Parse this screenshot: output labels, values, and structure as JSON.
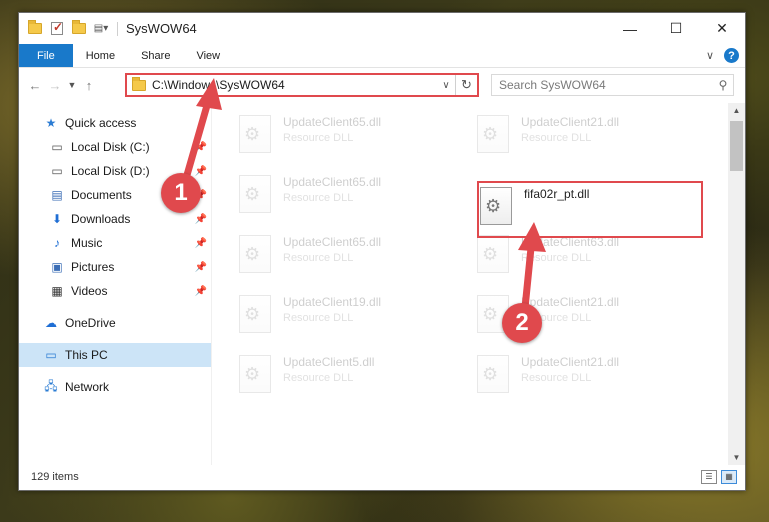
{
  "window": {
    "title": "SysWOW64",
    "controls": {
      "minimize": "—",
      "maximize": "☐",
      "close": "✕"
    }
  },
  "ribbon": {
    "tabs": [
      "File",
      "Home",
      "Share",
      "View"
    ],
    "expand_glyph": "∨",
    "help_glyph": "?"
  },
  "address_bar": {
    "path": "C:\\Windows\\SysWOW64",
    "search_placeholder": "Search SysWOW64"
  },
  "navigation": {
    "quick_access": "Quick access",
    "items": [
      {
        "label": "Local Disk (C:)",
        "icon": "drive-icon",
        "pinned": true
      },
      {
        "label": "Local Disk (D:)",
        "icon": "drive-icon",
        "pinned": true
      },
      {
        "label": "Documents",
        "icon": "documents-icon",
        "pinned": true
      },
      {
        "label": "Downloads",
        "icon": "downloads-icon",
        "pinned": true
      },
      {
        "label": "Music",
        "icon": "music-icon",
        "pinned": true
      },
      {
        "label": "Pictures",
        "icon": "pictures-icon",
        "pinned": true
      },
      {
        "label": "Videos",
        "icon": "videos-icon",
        "pinned": true
      }
    ],
    "onedrive": "OneDrive",
    "this_pc": "This PC",
    "network": "Network"
  },
  "files": {
    "left_column": [
      {
        "name": "UpdateClient65.dll",
        "type": "Resource DLL"
      },
      {
        "name": "UpdateClient65.dll",
        "type": "Resource DLL"
      },
      {
        "name": "UpdateClient65.dll",
        "type": "Resource DLL"
      },
      {
        "name": "UpdateClient19.dll",
        "type": "Resource DLL"
      },
      {
        "name": "UpdateClient5.dll",
        "type": "Resource DLL"
      }
    ],
    "right_column": [
      {
        "name": "UpdateClient21.dll",
        "type": "Resource DLL"
      },
      {
        "name": "fifa02r_pt.dll",
        "type": ""
      },
      {
        "name": "UpdateClient63.dll",
        "type": "Resource DLL"
      },
      {
        "name": "UpdateClient21.dll",
        "type": "Resource DLL"
      },
      {
        "name": "UpdateClient21.dll",
        "type": "Resource DLL"
      }
    ]
  },
  "status": {
    "item_count": "129 items"
  },
  "annotations": {
    "step1": "1",
    "step2": "2",
    "color": "#e0494d"
  }
}
